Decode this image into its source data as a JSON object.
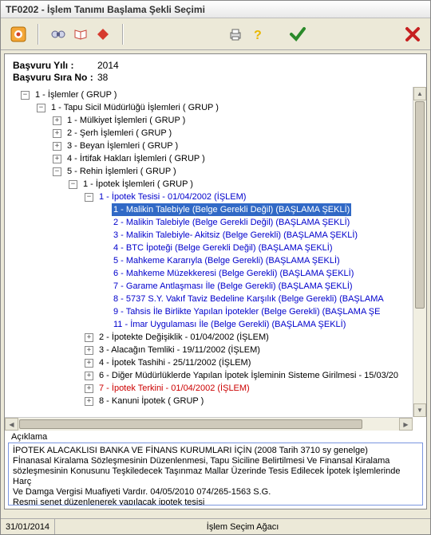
{
  "title": "TF0202 -  İşlem Tanımı Başlama Şekli Seçimi",
  "header": {
    "yil_label": "Başvuru Yılı  :",
    "yil_value": "2014",
    "sira_label": "Başvuru Sıra No :",
    "sira_value": "38"
  },
  "expand": {
    "plus": "+",
    "minus": "−"
  },
  "tree": {
    "n1": "1 - İşlemler ( GRUP )",
    "n1_1": "1 - Tapu Sicil Müdürlüğü İşlemleri ( GRUP )",
    "n1_1_1": "1 - Mülkiyet İşlemleri ( GRUP )",
    "n1_1_2": "2 - Şerh İşlemleri ( GRUP )",
    "n1_1_3": "3 - Beyan İşlemleri ( GRUP )",
    "n1_1_4": "4 - İrtifak Hakları İşlemleri ( GRUP )",
    "n1_1_5": "5 - Rehin İşlemleri ( GRUP )",
    "n1_1_5_1": "1 - İpotek İşlemleri ( GRUP )",
    "n1_1_5_1_1": "1 - İpotek Tesisi - 01/04/2002 (İŞLEM)",
    "n1_1_5_1_1_1": "1 - Malikin Talebiyle (Belge Gerekli Değil) (BAŞLAMA ŞEKLİ)",
    "n1_1_5_1_1_2": "2 - Malikin Talebiyle (Belge Gerekli Değil) (BAŞLAMA ŞEKLİ)",
    "n1_1_5_1_1_3": "3 - Malikin Talebiyle- Akitsiz (Belge Gerekli) (BAŞLAMA ŞEKLİ)",
    "n1_1_5_1_1_4": "4 - BTC İpoteği (Belge Gerekli Değil) (BAŞLAMA ŞEKLİ)",
    "n1_1_5_1_1_5": "5 - Mahkeme Kararıyla (Belge Gerekli) (BAŞLAMA ŞEKLİ)",
    "n1_1_5_1_1_6": "6 - Mahkeme Müzekkeresi (Belge Gerekli) (BAŞLAMA ŞEKLİ)",
    "n1_1_5_1_1_7": "7 - Garame Antlaşması İle (Belge Gerekli) (BAŞLAMA ŞEKLİ)",
    "n1_1_5_1_1_8": "8 - 5737 S.Y. Vakıf Taviz Bedeline Karşılık  (Belge Gerekli) (BAŞLAMA",
    "n1_1_5_1_1_9": "9 - Tahsis İle Birlikte Yapılan İpotekler (Belge Gerekli) (BAŞLAMA ŞE",
    "n1_1_5_1_1_11": "11 - İmar Uygulaması İle (Belge Gerekli) (BAŞLAMA ŞEKLİ)",
    "n1_1_5_1_2": "2 - İpotekte Değişiklik - 01/04/2002 (İŞLEM)",
    "n1_1_5_1_3": "3 - Alacağın Temliki - 19/11/2002 (İŞLEM)",
    "n1_1_5_1_4": "4 - İpotek Tashihi - 25/11/2002 (İŞLEM)",
    "n1_1_5_1_6": "6 - Diğer Müdürlüklerde Yapılan İpotek İşleminin Sisteme Girilmesi - 15/03/20",
    "n1_1_5_1_7": "7 - İpotek Terkini - 01/04/2002 (İŞLEM)",
    "n1_1_5_1_8": "8 - Kanuni İpotek ( GRUP )"
  },
  "desc": {
    "title": "Açıklama",
    "line1": "İPOTEK ALACAKLISI BANKA VE FİNANS KURUMLARI İÇİN (2008 Tarih 3710 sy genelge)",
    "line2": "Fİnanasal Kiralama Sözleşmesinin Düzenlenmesi, Tapu Siciline Belirtilmesi Ve Finansal Kiralama",
    "line3": "sözleşmesinin Konusunu Teşkiledecek Taşınmaz Mallar Üzerinde Tesis Edilecek İpotek İşlemlerinde Harç",
    "line4": "Ve Damga Vergisi Muafiyeti Vardır. 04/05/2010 074/265-1563 S.G.",
    "line5": "Resmi senet düzenlenerek yapılacak ipotek tesisi"
  },
  "status": {
    "date": "31/01/2014",
    "mid": "İşlem Seçim Ağacı"
  }
}
